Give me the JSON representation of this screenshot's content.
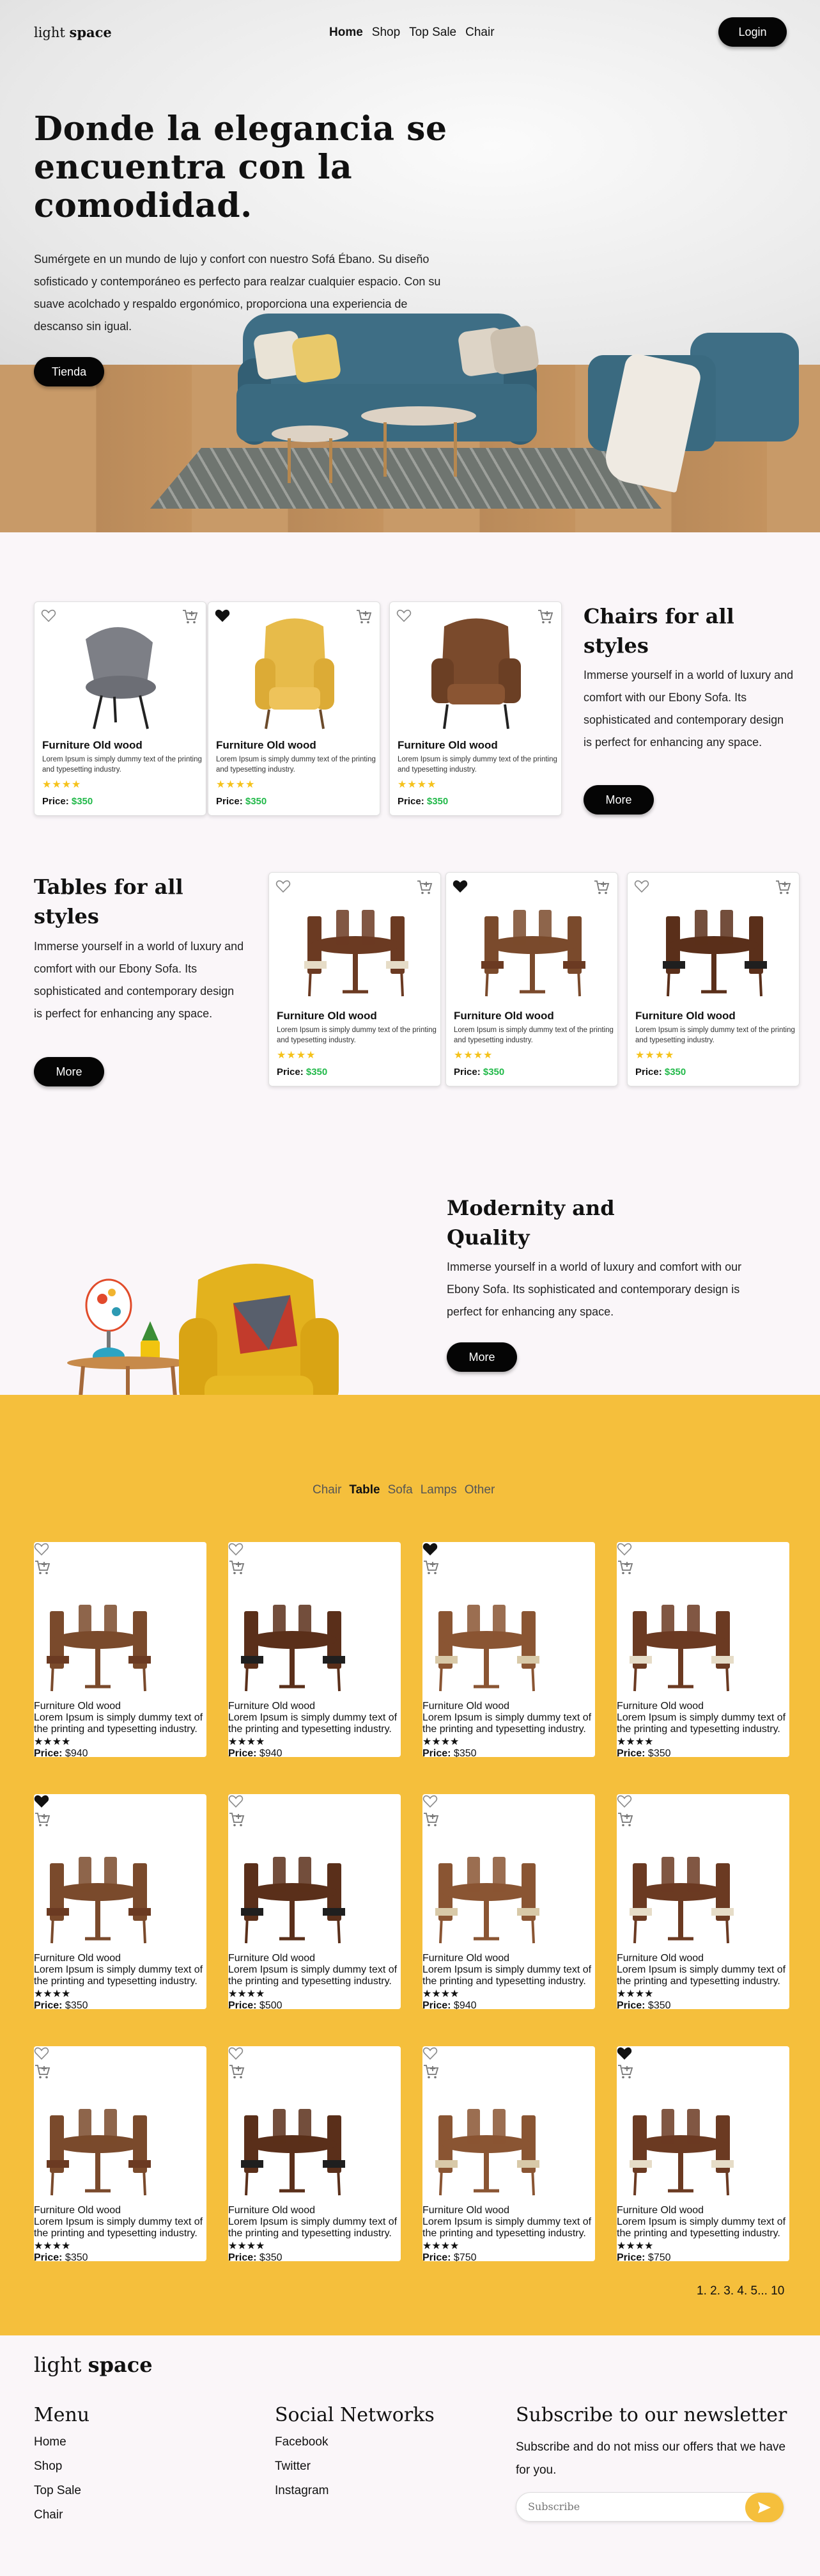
{
  "brand": {
    "light": "light",
    "bold": "space"
  },
  "nav": {
    "links": [
      "Home",
      "Shop",
      "Top Sale",
      "Chair"
    ],
    "login": "Login"
  },
  "hero": {
    "title": "Donde la elegancia se encuentra con la comodidad.",
    "text": "Sumérgete en un mundo de lujo y confort con nuestro Sofá Ébano. Su diseño sofisticado y contemporáneo es perfecto para realzar cualquier espacio. Con su suave acolchado y respaldo ergonómico, proporciona una experiencia de descanso sin igual.",
    "button": "Tienda"
  },
  "card_common": {
    "title": "Furniture Old wood",
    "desc": "Lorem Ipsum is simply dummy text of the printing and typesetting industry.",
    "stars": "★★★★",
    "price_label": "Price:"
  },
  "chairs": {
    "title": "Chairs for all styles",
    "text": "Immerse yourself in a world of luxury and comfort with our Ebony Sofa. Its sophisticated and contemporary design is perfect for enhancing any space.",
    "button": "More",
    "cards": [
      {
        "price": "$350",
        "liked": false,
        "img": "chair-grey"
      },
      {
        "price": "$350",
        "liked": true,
        "img": "chair-yellow"
      },
      {
        "price": "$350",
        "liked": false,
        "img": "chair-brown"
      }
    ]
  },
  "tables": {
    "title": "Tables for all styles",
    "text": "Immerse yourself in a world of luxury and comfort with our Ebony Sofa. Its sophisticated and contemporary design is perfect for enhancing any space.",
    "button": "More",
    "cards": [
      {
        "price": "$350",
        "liked": false
      },
      {
        "price": "$350",
        "liked": true
      },
      {
        "price": "$350",
        "liked": false
      }
    ]
  },
  "modernity": {
    "title": "Modernity and Quality",
    "text": "Immerse yourself in a world of luxury and comfort with our Ebony Sofa. Its sophisticated and contemporary design is perfect for enhancing any space.",
    "button": "More"
  },
  "catalog": {
    "filters": [
      "Chair",
      "Table",
      "Sofa",
      "Lamps",
      "Other"
    ],
    "active_filter": "Table",
    "cards": [
      {
        "price": "$940",
        "liked": false
      },
      {
        "price": "$940",
        "liked": false
      },
      {
        "price": "$350",
        "liked": true
      },
      {
        "price": "$350",
        "liked": false
      },
      {
        "price": "$350",
        "liked": true
      },
      {
        "price": "$500",
        "liked": false
      },
      {
        "price": "$940",
        "liked": false
      },
      {
        "price": "$350",
        "liked": false
      },
      {
        "price": "$350",
        "liked": false
      },
      {
        "price": "$350",
        "liked": false
      },
      {
        "price": "$750",
        "liked": false
      },
      {
        "price": "$750",
        "liked": true
      }
    ],
    "pagination": "1. 2. 3. 4. 5... 10"
  },
  "footer": {
    "menu_title": "Menu",
    "menu": [
      "Home",
      "Shop",
      "Top Sale",
      "Chair"
    ],
    "social_title": "Social Networks",
    "social": [
      "Facebook",
      "Twitter",
      "Instagram"
    ],
    "newsletter_title": "Subscribe to our newsletter",
    "newsletter_text": "Subscribe and do not miss our offers that we have for you.",
    "subscribe_placeholder": "Subscribe"
  },
  "colors": {
    "accent": "#f5bf3c",
    "price": "#22b94a",
    "star": "#f5c21b",
    "dark": "#050505"
  }
}
